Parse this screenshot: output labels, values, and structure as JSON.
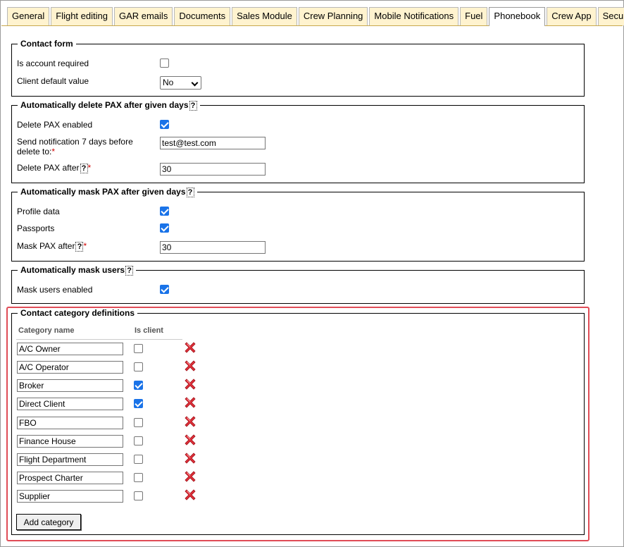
{
  "tabs": [
    {
      "label": "General"
    },
    {
      "label": "Flight editing"
    },
    {
      "label": "GAR emails"
    },
    {
      "label": "Documents"
    },
    {
      "label": "Sales Module"
    },
    {
      "label": "Crew Planning"
    },
    {
      "label": "Mobile Notifications"
    },
    {
      "label": "Fuel"
    },
    {
      "label": "Phonebook"
    },
    {
      "label": "Crew App"
    },
    {
      "label": "Security"
    }
  ],
  "active_tab": "Phonebook",
  "contact_form": {
    "legend": "Contact form",
    "is_account_required_label": "Is account required",
    "is_account_required": false,
    "client_default_label": "Client default value",
    "client_default_value": "No"
  },
  "delete_pax": {
    "legend": "Automatically delete PAX after given days",
    "help": "?",
    "enabled_label": "Delete PAX enabled",
    "enabled": true,
    "notify_label_line1": "Send notification 7 days before",
    "notify_label_line2": "delete to:",
    "required_mark": "*",
    "notify_email": "test@test.com",
    "after_label": "Delete PAX after",
    "after_days": "30"
  },
  "mask_pax": {
    "legend": "Automatically mask PAX after given days",
    "help": "?",
    "profile_label": "Profile data",
    "profile": true,
    "passports_label": "Passports",
    "passports": true,
    "after_label": "Mask PAX after",
    "after_days": "30"
  },
  "mask_users": {
    "legend": "Automatically mask users",
    "help": "?",
    "enabled_label": "Mask users enabled",
    "enabled": true
  },
  "categories": {
    "legend": "Contact category definitions",
    "col_name": "Category name",
    "col_client": "Is client",
    "rows": [
      {
        "name": "A/C Owner",
        "is_client": false
      },
      {
        "name": "A/C Operator",
        "is_client": false
      },
      {
        "name": "Broker",
        "is_client": true
      },
      {
        "name": "Direct Client",
        "is_client": true
      },
      {
        "name": "FBO",
        "is_client": false
      },
      {
        "name": "Finance House",
        "is_client": false
      },
      {
        "name": "Flight Department",
        "is_client": false
      },
      {
        "name": "Prospect Charter",
        "is_client": false
      },
      {
        "name": "Supplier",
        "is_client": false
      }
    ],
    "add_button": "Add category"
  },
  "colors": {
    "tab_bg": "#fff3cf",
    "highlight": "#e04c57",
    "checkbox_checked": "#1a73e8",
    "delete_icon": "#e0303a"
  },
  "icons": {
    "delete": "red-x-delete-icon",
    "checkbox": "checkbox-icon"
  }
}
